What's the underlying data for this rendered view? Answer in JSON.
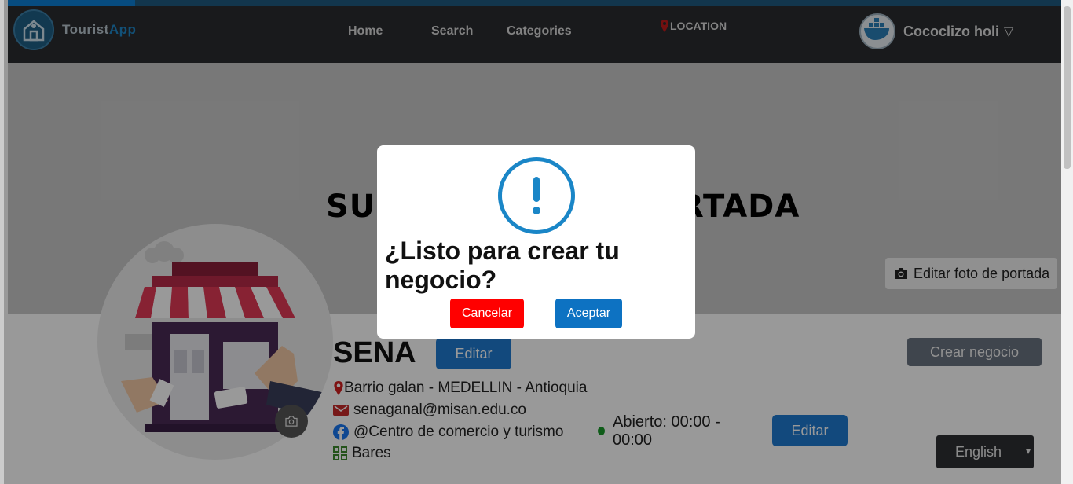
{
  "progress": {
    "value": 0.12
  },
  "navbar": {
    "logo_text_1": "Tourist",
    "logo_text_2": "App",
    "links": [
      "Home",
      "Search",
      "Categories"
    ],
    "location_label": "LOCATION",
    "user_name": "Cococlizo holi",
    "caret": "▽"
  },
  "cover": {
    "text_left": "SUB",
    "text_right": "ORTADA",
    "edit_label": "Editar foto de portada"
  },
  "business": {
    "name": "SENA",
    "edit_label": "Editar",
    "address": "Barrio galan - MEDELLIN - Antioquia",
    "email": "senaganal@misan.edu.co",
    "facebook": "@Centro de comercio y turismo",
    "category": "Bares",
    "status_line1": "Abierto: 00:00 -",
    "status_line2": "00:00",
    "status_edit_label": "Editar",
    "create_label": "Crear negocio"
  },
  "language": {
    "selected": "English"
  },
  "modal": {
    "title": "¿Listo para crear tu negocio?",
    "cancel_label": "Cancelar",
    "accept_label": "Aceptar"
  },
  "colors": {
    "accent": "#1f7ad1",
    "cancel": "#ff0000",
    "nav_bg": "#2a2c30",
    "status_open": "#1a9a2a"
  }
}
